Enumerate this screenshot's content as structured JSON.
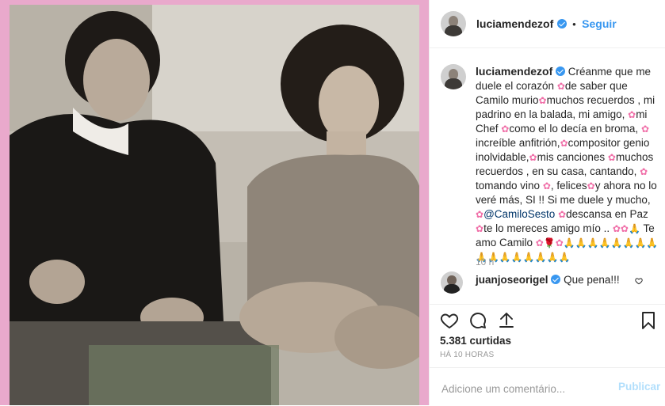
{
  "post": {
    "image_alt": "Foto en blanco y negro de un hombre y una mujer sentados en un sofá",
    "frame_color": "#e9a9cc"
  },
  "header": {
    "username": "luciamendezof",
    "separator": "•",
    "follow_label": "Seguir"
  },
  "caption": {
    "username": "luciamendezof",
    "segments": [
      {
        "type": "text",
        "value": " Créanme que me duele el corazón "
      },
      {
        "type": "emoji",
        "value": "✿"
      },
      {
        "type": "text",
        "value": "de saber que Camilo murio"
      },
      {
        "type": "emoji",
        "value": "✿"
      },
      {
        "type": "text",
        "value": "muchos recuerdos , mi padrino en la balada, mi amigo, "
      },
      {
        "type": "emoji",
        "value": "✿"
      },
      {
        "type": "text",
        "value": "mi Chef "
      },
      {
        "type": "emoji",
        "value": "✿"
      },
      {
        "type": "text",
        "value": "como el lo decía en broma, "
      },
      {
        "type": "emoji",
        "value": "✿"
      },
      {
        "type": "text",
        "value": " increíble anfitrión,"
      },
      {
        "type": "emoji",
        "value": "✿"
      },
      {
        "type": "text",
        "value": "compositor genio inolvidable,"
      },
      {
        "type": "emoji",
        "value": "✿"
      },
      {
        "type": "text",
        "value": "mis canciones "
      },
      {
        "type": "emoji",
        "value": "✿"
      },
      {
        "type": "text",
        "value": "muchos recuerdos , en su casa, cantando, "
      },
      {
        "type": "emoji",
        "value": "✿"
      },
      {
        "type": "text",
        "value": " tomando vino "
      },
      {
        "type": "emoji",
        "value": "✿"
      },
      {
        "type": "text",
        "value": ", felices"
      },
      {
        "type": "emoji",
        "value": "✿"
      },
      {
        "type": "text",
        "value": "y ahora no lo veré más, SI !! Si me duele y mucho, "
      },
      {
        "type": "emoji",
        "value": "✿"
      },
      {
        "type": "mention",
        "value": "@CamiloSesto"
      },
      {
        "type": "text",
        "value": " "
      },
      {
        "type": "emoji",
        "value": "✿"
      },
      {
        "type": "text",
        "value": "descansa en Paz "
      },
      {
        "type": "emoji",
        "value": "✿"
      },
      {
        "type": "text",
        "value": "te lo mereces amigo mío .. "
      },
      {
        "type": "emoji",
        "value": "✿✿🙏"
      },
      {
        "type": "text",
        "value": " Te amo Camilo "
      },
      {
        "type": "emoji",
        "value": "✿🌹✿🙏🙏🙏🙏🙏🙏🙏🙏🙏🙏🙏🙏🙏🙏🙏🙏"
      }
    ],
    "time": "10 h"
  },
  "reply": {
    "username": "juanjoseorigel",
    "text": "Que pena!!!"
  },
  "stats": {
    "likes": "5.381 curtidas",
    "time_ago": "HÁ 10 HORAS"
  },
  "comment_box": {
    "placeholder": "Adicione um comentário...",
    "publish_label": "Publicar"
  },
  "colors": {
    "link": "#3897f0",
    "mention": "#003569",
    "muted": "#999999",
    "publish_disabled": "#b2dffc"
  },
  "icons": [
    "heart-icon",
    "comment-icon",
    "share-icon",
    "bookmark-icon",
    "verified-badge-icon",
    "small-heart-icon"
  ]
}
